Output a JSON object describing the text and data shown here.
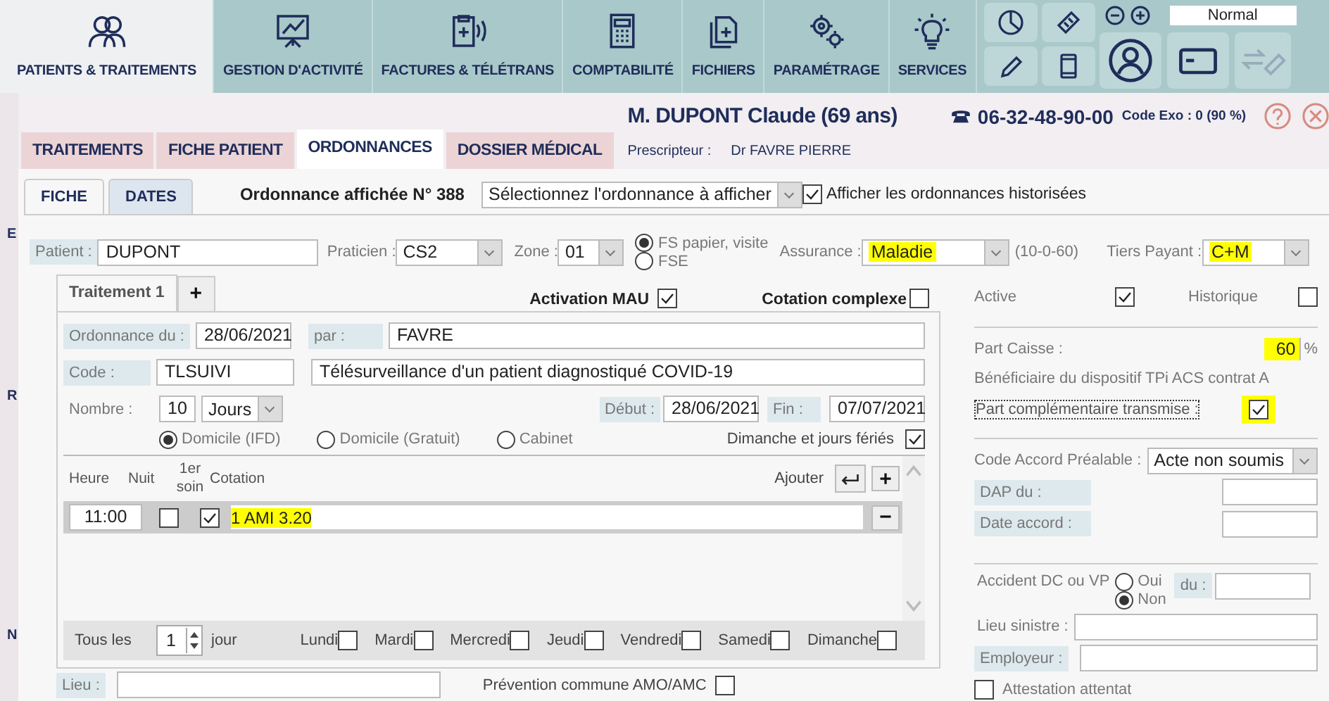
{
  "nav_tabs": [
    {
      "label": "PATIENTS & TRAITEMENTS",
      "selected": true
    },
    {
      "label": "GESTION D'ACTIVITÉ",
      "selected": false
    },
    {
      "label": "FACTURES & TÉLÉTRANS",
      "selected": false
    },
    {
      "label": "COMPTABILITÉ",
      "selected": false
    },
    {
      "label": "FICHIERS",
      "selected": false
    },
    {
      "label": "PARAMÉTRAGE",
      "selected": false
    },
    {
      "label": "SERVICES",
      "selected": false
    }
  ],
  "zoom_select": "Normal",
  "patient_header": {
    "name": "M. DUPONT Claude (69 ans)",
    "phone": "06-32-48-90-00",
    "code_exo": "Code Exo : 0 (90 %)"
  },
  "section_tabs": [
    {
      "label": "TRAITEMENTS",
      "selected": false
    },
    {
      "label": "FICHE PATIENT",
      "selected": false
    },
    {
      "label": "ORDONNANCES",
      "selected": true
    },
    {
      "label": "DOSSIER MÉDICAL",
      "selected": false
    }
  ],
  "prescripteur": {
    "label": "Prescripteur :",
    "value": "Dr FAVRE PIERRE"
  },
  "sidebar_letters": [
    "E",
    "R",
    "N"
  ],
  "sub_tabs": [
    {
      "label": "FICHE",
      "selected": true
    },
    {
      "label": "DATES",
      "selected": false
    }
  ],
  "ordonnance_title": "Ordonnance affichée N° 388",
  "ordonnance_select": "Sélectionnez l'ordonnance à afficher",
  "show_history": {
    "label": "Afficher les ordonnances historisées",
    "checked": true
  },
  "patient": {
    "label": "Patient :",
    "value": "DUPONT"
  },
  "praticien": {
    "label": "Praticien :",
    "value": "CS2"
  },
  "zone": {
    "label": "Zone :",
    "value": "01"
  },
  "fs_options": [
    {
      "label": "FS papier, visite",
      "selected": true
    },
    {
      "label": "FSE",
      "selected": false
    }
  ],
  "assurance": {
    "label": "Assurance :",
    "value": "Maladie",
    "highlighted": true,
    "note": "(10-0-60)"
  },
  "tiers_payant": {
    "label": "Tiers Payant :",
    "value": "C+M",
    "highlighted": true
  },
  "treatment_tabs": [
    {
      "label": "Traitement 1",
      "selected": true
    }
  ],
  "add_tab": "+",
  "activation_mau": {
    "label": "Activation MAU",
    "checked": true
  },
  "cotation_complexe": {
    "label": "Cotation complexe",
    "checked": false
  },
  "ordonnance_du": {
    "label": "Ordonnance du :",
    "value": "28/06/2021"
  },
  "par": {
    "label": "par :",
    "value": "FAVRE"
  },
  "code": {
    "label": "Code :",
    "value": "TLSUIVI",
    "description": "Télésurveillance d'un patient diagnostiqué COVID-19"
  },
  "nombre": {
    "label": "Nombre :",
    "value": "10",
    "unit": "Jours"
  },
  "debut": {
    "label": "Début :",
    "value": "28/06/2021"
  },
  "fin": {
    "label": "Fin :",
    "value": "07/07/2021"
  },
  "lieu_options": [
    {
      "label": "Domicile (IFD)",
      "selected": true
    },
    {
      "label": "Domicile (Gratuit)",
      "selected": false
    },
    {
      "label": "Cabinet",
      "selected": false
    }
  ],
  "dimanche_feries": {
    "label": "Dimanche et jours fériés",
    "checked": true
  },
  "acts_table": {
    "columns": [
      "Heure",
      "Nuit",
      "1er soin",
      "Cotation"
    ],
    "add_label": "Ajouter",
    "add_button": "+",
    "remove_button": "−",
    "rows": [
      {
        "heure": "11:00",
        "nuit": false,
        "premier_soin": true,
        "cotation": "1 AMI 3.20",
        "highlighted": true
      }
    ]
  },
  "repeat": {
    "label": "Tous les",
    "value": "1",
    "unit": "jour"
  },
  "days": [
    {
      "label": "Lundi",
      "checked": false
    },
    {
      "label": "Mardi",
      "checked": false
    },
    {
      "label": "Mercredi",
      "checked": false
    },
    {
      "label": "Jeudi",
      "checked": false
    },
    {
      "label": "Vendredi",
      "checked": false
    },
    {
      "label": "Samedi",
      "checked": false
    },
    {
      "label": "Dimanche",
      "checked": false
    }
  ],
  "lieu": {
    "label": "Lieu :"
  },
  "prevention": {
    "label": "Prévention commune AMO/AMC",
    "checked": false
  },
  "active": {
    "label": "Active",
    "checked": true
  },
  "historique": {
    "label": "Historique",
    "checked": false
  },
  "part_caisse": {
    "label": "Part Caisse :",
    "value": "60",
    "unit": "%",
    "highlighted": true
  },
  "beneficiaire": "Bénéficiaire du dispositif TPi ACS contrat A",
  "part_complementaire": {
    "label": "Part complémentaire transmise :",
    "checked": true,
    "highlighted": true
  },
  "code_accord": {
    "label": "Code Accord Préalable :",
    "value": "Acte non soumis"
  },
  "dap": {
    "label": "DAP du :"
  },
  "date_accord": {
    "label": "Date accord :"
  },
  "accident": {
    "label": "Accident DC ou VP",
    "options": [
      {
        "label": "Oui",
        "selected": false
      },
      {
        "label": "Non",
        "selected": true
      }
    ],
    "du_label": "du :"
  },
  "lieu_sinistre": {
    "label": "Lieu sinistre :"
  },
  "employeur": {
    "label": "Employeur :"
  },
  "attestation": {
    "label": "Attestation attentat",
    "checked": false
  }
}
